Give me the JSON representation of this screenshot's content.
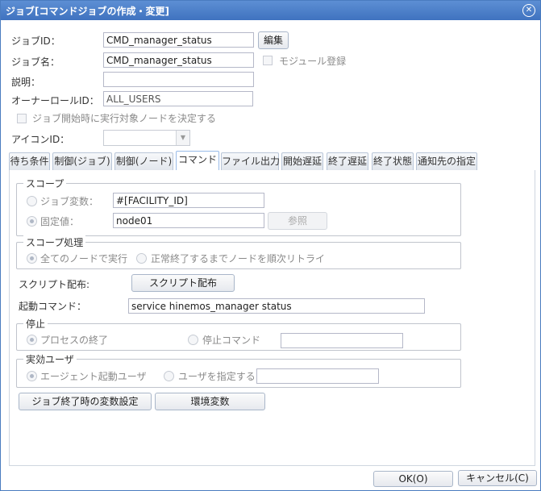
{
  "window": {
    "title": "ジョブ[コマンドジョブの作成・変更]",
    "close_icon": "close-circle-icon"
  },
  "form": {
    "job_id_label": "ジョブID：",
    "job_id_value": "CMD_manager_status",
    "edit_button": "編集",
    "job_name_label": "ジョブ名：",
    "job_name_value": "CMD_manager_status",
    "module_label": "モジュール登録",
    "desc_label": "説明：",
    "desc_value": "",
    "owner_label": "オーナーロールID：",
    "owner_value": "ALL_USERS",
    "decide_node_label": "ジョブ開始時に実行対象ノードを決定する",
    "icon_id_label": "アイコンID："
  },
  "tabs": [
    "待ち条件",
    "制御(ジョブ)",
    "制御(ノード)",
    "コマンド",
    "ファイル出力",
    "開始遅延",
    "終了遅延",
    "終了状態",
    "通知先の指定"
  ],
  "active_tab": "コマンド",
  "scope": {
    "legend": "スコープ",
    "job_var_label": "ジョブ変数：",
    "job_var_value": "#[FACILITY_ID]",
    "fixed_label": "固定値：",
    "fixed_value": "node01",
    "ref_button": "参照"
  },
  "scope_proc": {
    "legend": "スコープ処理",
    "all_nodes": "全てのノードで実行",
    "retry": "正常終了するまでノードを順次リトライ"
  },
  "script": {
    "label": "スクリプト配布:",
    "button": "スクリプト配布"
  },
  "start_cmd": {
    "label": "起動コマンド：",
    "value": "service hinemos_manager status"
  },
  "stop": {
    "legend": "停止",
    "process_end": "プロセスの終了",
    "stop_cmd": "停止コマンド",
    "stop_cmd_value": ""
  },
  "user": {
    "legend": "実効ユーザ",
    "agent_user": "エージェント起動ユーザ",
    "specify_user": "ユーザを指定する",
    "user_value": ""
  },
  "buttons": {
    "var_settings": "ジョブ終了時の変数設定",
    "env_vars": "環境変数",
    "ok": "OK(O)",
    "cancel": "キャンセル(C)"
  }
}
